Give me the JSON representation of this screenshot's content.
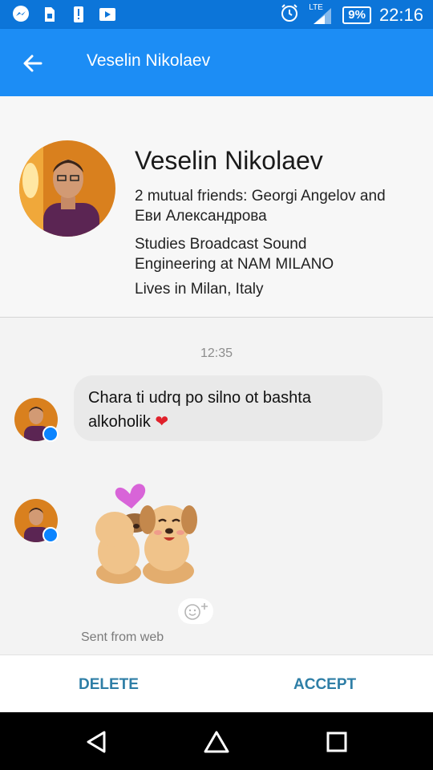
{
  "status_bar": {
    "icons": [
      "messenger-icon",
      "sim-icon",
      "alert-icon",
      "video-icon"
    ],
    "network": "LTE",
    "battery": "9%",
    "time": "22:16"
  },
  "app_bar": {
    "title": "Veselin Nikolaev",
    "back_icon": "back-arrow-icon"
  },
  "profile": {
    "name": "Veselin Nikolaev",
    "mutual_line1": "2 mutual friends: Georgi Angelov and",
    "mutual_line2": "Еви Александрова",
    "studies_line1": "Studies Broadcast Sound",
    "studies_line2": "Engineering at NAM MILANO",
    "lives": "Lives in Milan, Italy"
  },
  "chat": {
    "timestamp": "12:35",
    "message_line1": "Chara ti udrq po silno ot bashta",
    "message_line2": "alkoholik",
    "message_emoji": "❤",
    "react_icon": "add-reaction-icon",
    "sent_from": "Sent from web"
  },
  "actions": {
    "delete": "DELETE",
    "accept": "ACCEPT"
  },
  "nav": [
    "back-triangle-icon",
    "home-icon",
    "recents-icon"
  ],
  "colors": {
    "status_bar": "#0c75d9",
    "app_bar": "#1c8df5",
    "action_text": "#2e7ea6",
    "heart": "#e0212b"
  }
}
